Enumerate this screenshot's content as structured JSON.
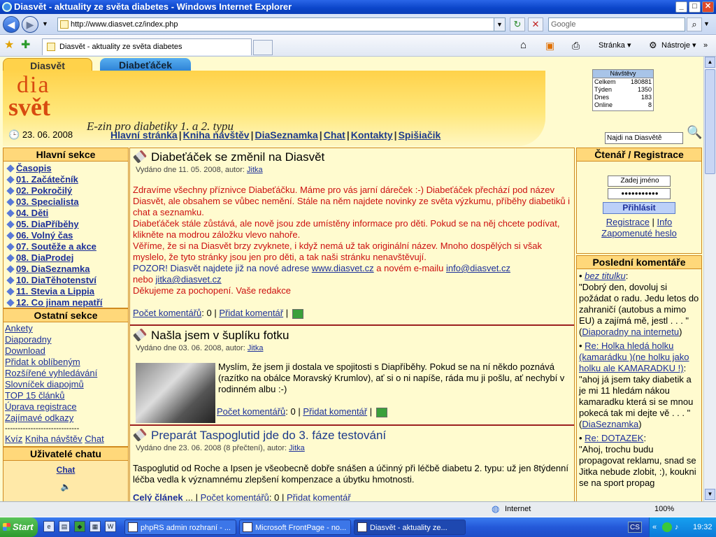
{
  "window": {
    "title": "Diasvět - aktuality ze světa diabetes - Windows Internet Explorer",
    "min": "_",
    "max": "□",
    "close": "✕"
  },
  "address": {
    "url": "http://www.diasvet.cz/index.php",
    "search_placeholder": "Google",
    "refresh": "↻",
    "stop": "✕",
    "go": "⌕"
  },
  "tabs": {
    "active": "Diasvět - aktuality ze světa diabetes"
  },
  "toolbar": {
    "page": "Stránka ▾",
    "tools": "Nástroje ▾"
  },
  "site": {
    "tab_diasvet": "Diasvět",
    "tab_diabetacek": "Diabeťáček",
    "logo_line1": "dia",
    "logo_line2": "svět",
    "slogan": "E-zin pro diabetiky 1. a 2. typu",
    "date": "23. 06. 2008",
    "menu": [
      "Hlavní stránka",
      "Kniha návštěv",
      "DiaSeznamka",
      "Chat",
      "Kontakty",
      "Spišiačik"
    ],
    "search_placeholder": "Najdi na Diasvětě",
    "visits": {
      "title": "Návštěvy",
      "rows": [
        [
          "Celkem",
          "180881"
        ],
        [
          "Týden",
          "1350"
        ],
        [
          "Dnes",
          "183"
        ],
        [
          "Online",
          "8"
        ]
      ]
    }
  },
  "left": {
    "main_title": "Hlavní sekce",
    "main_items": [
      "Časopis",
      "01. Začátečník",
      "02. Pokročilý",
      "03. Specialista",
      "04. Děti",
      "05. DiaPříběhy",
      "06. Volný čas",
      "07. Soutěže a akce",
      "08. DiaProdej",
      "09. DiaSeznamka",
      "10. DiaTěhotenství",
      "11. Stevia a Lippia",
      "12. Co jinam nepatří"
    ],
    "other_title": "Ostatní sekce",
    "other_items": [
      "Ankety",
      "Diaporadny",
      "Download",
      "Přidat k oblíbeným",
      "Rozšířené vyhledávání",
      "Slovníček diapojmů",
      "TOP 15 článků",
      "Úprava registrace",
      "Zajímavé odkazy"
    ],
    "divider": "-----------------------------",
    "bottom_links": [
      "Kvíz",
      "Kniha návštěv",
      "Chat"
    ],
    "chat_title": "Uživatelé chatu",
    "chat_link": "Chat",
    "sound_icon": "🔈"
  },
  "articles": [
    {
      "title": "Diabeťáček se změnil na Diasvět",
      "meta_prefix": "Vydáno dne 11. 05. 2008, autor: ",
      "author": "Jitka",
      "p1": "Zdravíme všechny příznivce Diabeťáčku. Máme pro vás jarní dáreček :-) Diabeťáček přechází pod název Diasvět, ale obsahem se vůbec nemění. Stále na něm najdete novinky ze světa výzkumu, příběhy diabetiků i chat a seznamku.",
      "p2": "Diabeťáček stále zůstává, ale nově jsou zde umístěny informace pro děti. Pokud se na něj chcete podívat, klikněte na modrou záložku vlevo nahoře.",
      "p3": "Věříme, že si na Diasvět brzy zvyknete, i když nemá už tak originální název. Mnoho dospělých si však myslelo, že tyto stránky jsou jen pro děti, a tak naši stránku nenavštěvují.",
      "p4a": "POZOR! Diasvět najdete již na nové adrese ",
      "p4link": "www.diasvet.cz",
      "p4b": " a novém e-mailu ",
      "p4mail": "info@diasvet.cz",
      "p4c": "nebo ",
      "p4mail2": "jitka@diasvet.cz",
      "p5": "Děkujeme za pochopení. Vaše redakce",
      "comments_label": "Počet komentářů",
      "comments": "0",
      "add_comment": "Přidat komentář"
    },
    {
      "title": "Našla jsem v šuplíku fotku",
      "meta_prefix": "Vydáno dne 03. 06. 2008, autor: ",
      "author": "Jitka",
      "text": "Myslím, že jsem ji dostala ve spojitosti s Diapříběhy. Pokud se na ní někdo poznává (razítko na obálce Moravský Krumlov), ať si o ni napíše, ráda mu ji pošlu, ať nechybí v rodinném albu :-)",
      "comments_label": "Počet komentářů",
      "comments": "0",
      "add_comment": "Přidat komentář"
    },
    {
      "title": "Preparát Taspoglutid jde do 3. fáze testování",
      "meta_prefix": "Vydáno dne 23. 06. 2008 (8 přečtení), autor: ",
      "author": "Jitka",
      "text": "Taspoglutid od Roche a Ipsen je všeobecně dobře snášen a účinný při léčbě diabetu 2. typu: už jen 8týdenní léčba vedla k významnému zlepšení kompenzace a úbytku hmotnosti.",
      "full": "Celý článek",
      "comments_label": "Počet komentářů",
      "comments": "0",
      "add_comment": "Přidat komentář"
    }
  ],
  "right": {
    "login_title": "Čtenář / Registrace",
    "name_placeholder": "Zadej jméno",
    "password_mask": "●●●●●●●●●●●",
    "login_button": "Přihlásit",
    "register": "Registrace",
    "info": "Info",
    "forgot": "Zapomenuté heslo",
    "comments_title": "Poslední komentáře",
    "comments": [
      {
        "title": "bez titulku",
        "text": "\"Dobrý den, dovoluj si požádat o radu. Jedu letos do zahraničí (autobus a mimo EU) a zajímá mě, jestl . . . \"",
        "source": "Diaporadny na internetu"
      },
      {
        "title": "Re: Holka hledá holku (kamarádku )(ne holku jako holku ale KAMARADKU !)",
        "text": "\"ahoj já jsem taky diabetik a je mi 11 hledám nákou kamaradku která si se mnou pokecá tak mi dejte vě . . . \"",
        "source": "DiaSeznamka"
      },
      {
        "title": "Re: DOTAZEK",
        "text": "\"Ahoj, trochu budu propagovat reklamu, snad se Jitka nebude zlobit, :), koukni se na sport propag"
      }
    ]
  },
  "statusbar": {
    "zone": "Internet",
    "zoom": "100%"
  },
  "taskbar": {
    "start": "Start",
    "tasks": [
      "phpRS admin rozhraní - ...",
      "Microsoft FrontPage - no...",
      "Diasvět - aktuality ze..."
    ],
    "lang": "CS",
    "clock": "19:32"
  }
}
